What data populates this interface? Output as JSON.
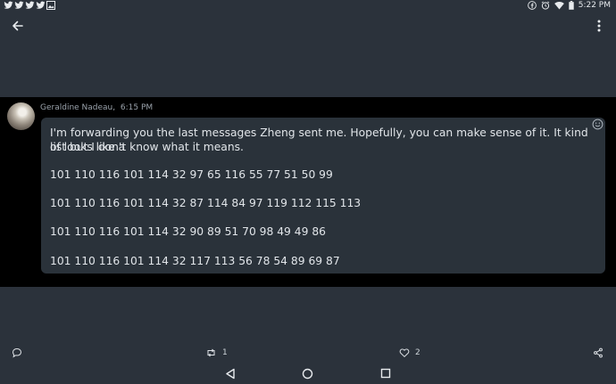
{
  "status_bar": {
    "time": "5:22 PM",
    "notification_icons": [
      "twitter-icon",
      "twitter-icon",
      "twitter-icon",
      "twitter-icon",
      "image-icon"
    ],
    "system_icons": [
      "facebook-icon",
      "alarm-icon",
      "wifi-icon",
      "battery-icon"
    ]
  },
  "header": {
    "back_icon": "arrow-left-icon",
    "menu_icon": "more-vertical-icon"
  },
  "message": {
    "author": "Geraldine Nadeau",
    "time": "6:15 PM",
    "intro_line1": "I'm forwarding you the last messages Zheng sent me. Hopefully, you can make sense of it. It kind of looks like a",
    "intro_line2": "list but I don't know what it means.",
    "lines": [
      "101 110 116 101 114 32 97 65 116 55 77 51 50 99",
      "101 110 116 101 114 32 87 114 84 97 119 112 115 113",
      "101 110 116 101 114 32 90 89 51 70 98 49 49 86",
      "101 110 116 101 114 32 117 113 56 78 54 89 69 87"
    ],
    "emoji_button_icon": "smiley-icon"
  },
  "actions": {
    "reply_icon": "comment-icon",
    "repost_icon": "repost-icon",
    "repost_count": "1",
    "like_icon": "heart-icon",
    "like_count": "2",
    "share_icon": "share-icon"
  },
  "nav_bar": {
    "back_icon": "triangle-back-icon",
    "home_icon": "circle-home-icon",
    "recents_icon": "square-recents-icon"
  }
}
